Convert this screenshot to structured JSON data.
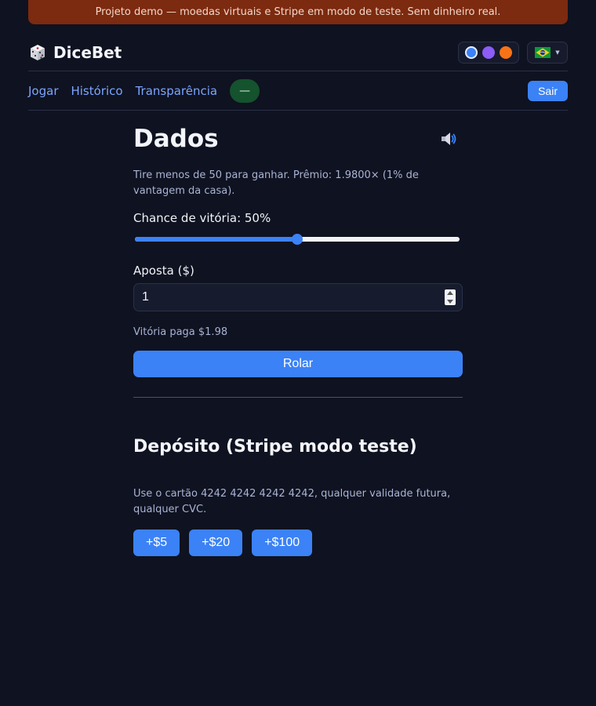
{
  "banner": {
    "text": "Projeto demo — moedas virtuais e Stripe em modo de teste. Sem dinheiro real."
  },
  "header": {
    "brand_name": "DiceBet",
    "brand_icon": "dice-icon",
    "themes": [
      {
        "name": "blue",
        "color": "#3b82f6"
      },
      {
        "name": "purple",
        "color": "#8b5cf6"
      },
      {
        "name": "orange",
        "color": "#f97316"
      }
    ],
    "language_icon": "brazil-flag-icon"
  },
  "nav": {
    "links": [
      "Jogar",
      "Histórico",
      "Transparência"
    ],
    "balance": "—",
    "logout_label": "Sair"
  },
  "game": {
    "title": "Dados",
    "sound_icon": "speaker-icon",
    "description": "Tire menos de 50 para ganhar. Prêmio: 1.9800× (1% de vantagem da casa).",
    "chance_label": "Chance de vitória: 50%",
    "chance_value": 50,
    "bet_label": "Aposta ($)",
    "bet_value": "1",
    "payout_text": "Vitória paga $1.98",
    "roll_label": "Rolar"
  },
  "deposit": {
    "title": "Depósito (Stripe modo teste)",
    "description": "Use o cartão 4242 4242 4242 4242, qualquer validade futura, qualquer CVC.",
    "buttons": [
      "+$5",
      "+$20",
      "+$100"
    ]
  },
  "colors": {
    "accent": "#3b82f6",
    "background": "#0f1220",
    "banner": "#7c2a10",
    "balance_pill": "#14532d"
  }
}
